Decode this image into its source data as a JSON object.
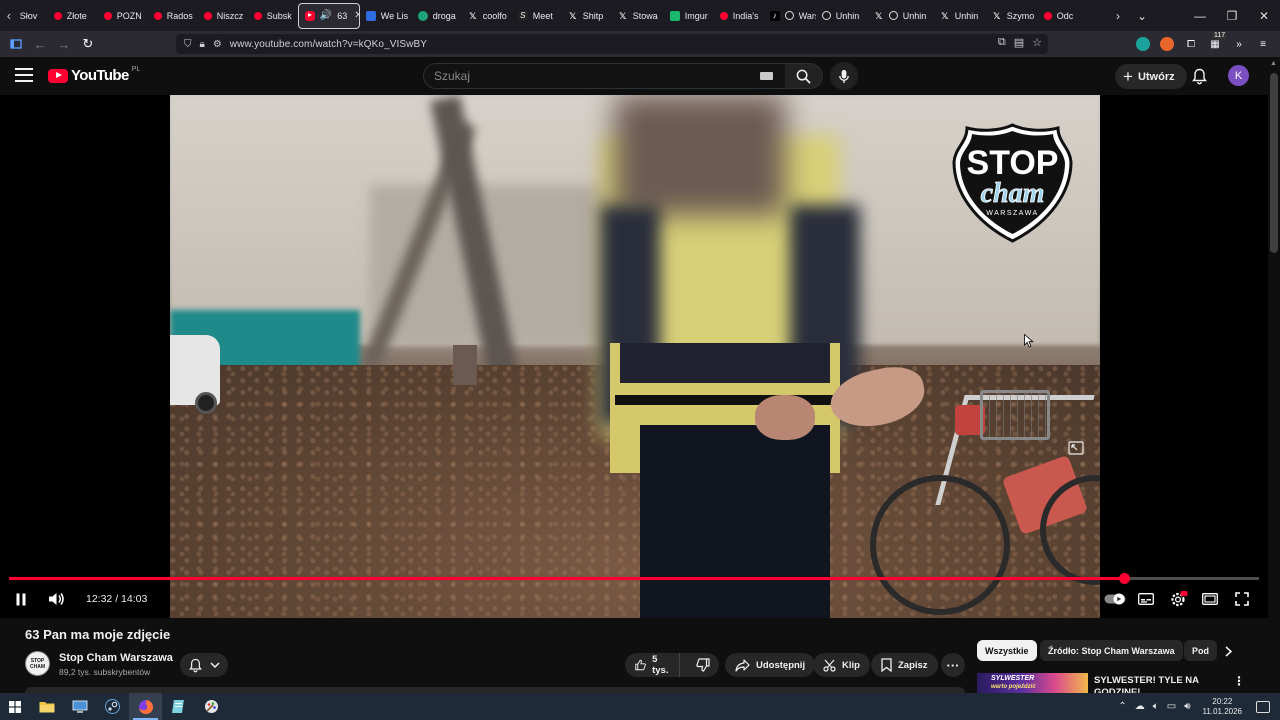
{
  "browser": {
    "tabs": [
      {
        "label": "Słov",
        "icon": "none"
      },
      {
        "label": "Złote",
        "icon": "youtube-icon"
      },
      {
        "label": "POZN",
        "icon": "youtube-icon"
      },
      {
        "label": "Rados",
        "icon": "youtube-icon"
      },
      {
        "label": "Niszcz",
        "icon": "youtube-icon"
      },
      {
        "label": "Subsk",
        "icon": "youtube-icon"
      },
      {
        "label": "63",
        "icon": "youtube-icon",
        "active": true,
        "audio": true
      },
      {
        "label": "We Lis",
        "icon": "gif-icon"
      },
      {
        "label": "droga",
        "icon": "green-icon"
      },
      {
        "label": "coolfo",
        "icon": "x-icon"
      },
      {
        "label": "Meet",
        "icon": "s-icon"
      },
      {
        "label": "Shitp",
        "icon": "x-icon"
      },
      {
        "label": "Stowa",
        "icon": "x-icon"
      },
      {
        "label": "Imgur",
        "icon": "imgur-icon"
      },
      {
        "label": "India's",
        "icon": "youtube-icon"
      },
      {
        "label": "Warsz",
        "icon": "tiktok-icon"
      },
      {
        "label": "Unhin",
        "icon": "x-icon"
      },
      {
        "label": "Unhin",
        "icon": "x-icon"
      },
      {
        "label": "Unhin",
        "icon": "x-icon"
      },
      {
        "label": "Szymo",
        "icon": "x-icon"
      },
      {
        "label": "Odc",
        "icon": "youtube-icon"
      }
    ],
    "url": "www.youtube.com/watch?v=kQKo_VISwBY",
    "extension_badge": "117"
  },
  "youtube": {
    "logo_text": "YouTube",
    "region": "PL",
    "search_placeholder": "Szukaj",
    "create_label": "Utwórz",
    "avatar_letter": "K"
  },
  "player": {
    "current_time": "12:32",
    "duration": "14:03",
    "time_separator": " / ",
    "progress_fraction": 0.8921,
    "watermark": {
      "top": "STOP",
      "middle": "cham",
      "bottom": "WARSZAWA"
    }
  },
  "video": {
    "title": "63 Pan ma moje zdjęcie",
    "channel_name": "Stop Cham Warszawa",
    "subscribers": "89,2 tys. subskrybentów",
    "likes": "5 tys.",
    "share_label": "Udostępnij",
    "clip_label": "Klip",
    "save_label": "Zapisz",
    "channel_avatar_text": "STOP CHAM"
  },
  "sidebar": {
    "chips": [
      {
        "label": "Wszystkie",
        "active": true
      },
      {
        "label": "Źródło: Stop Cham Warszawa",
        "active": false
      },
      {
        "label": "Pod",
        "active": false
      }
    ],
    "recommendation": {
      "title": "SYLWESTER! TYLE NA GODZINĘ!",
      "thumb_line1": "SYLWESTER",
      "thumb_line2": "warto pojeździć"
    }
  },
  "taskbar": {
    "time": "20:22",
    "date": "11.01.2026"
  },
  "colors": {
    "accent": "#ff0033",
    "background": "#0f0f0f",
    "chip_active_bg": "#f1f1f1"
  }
}
